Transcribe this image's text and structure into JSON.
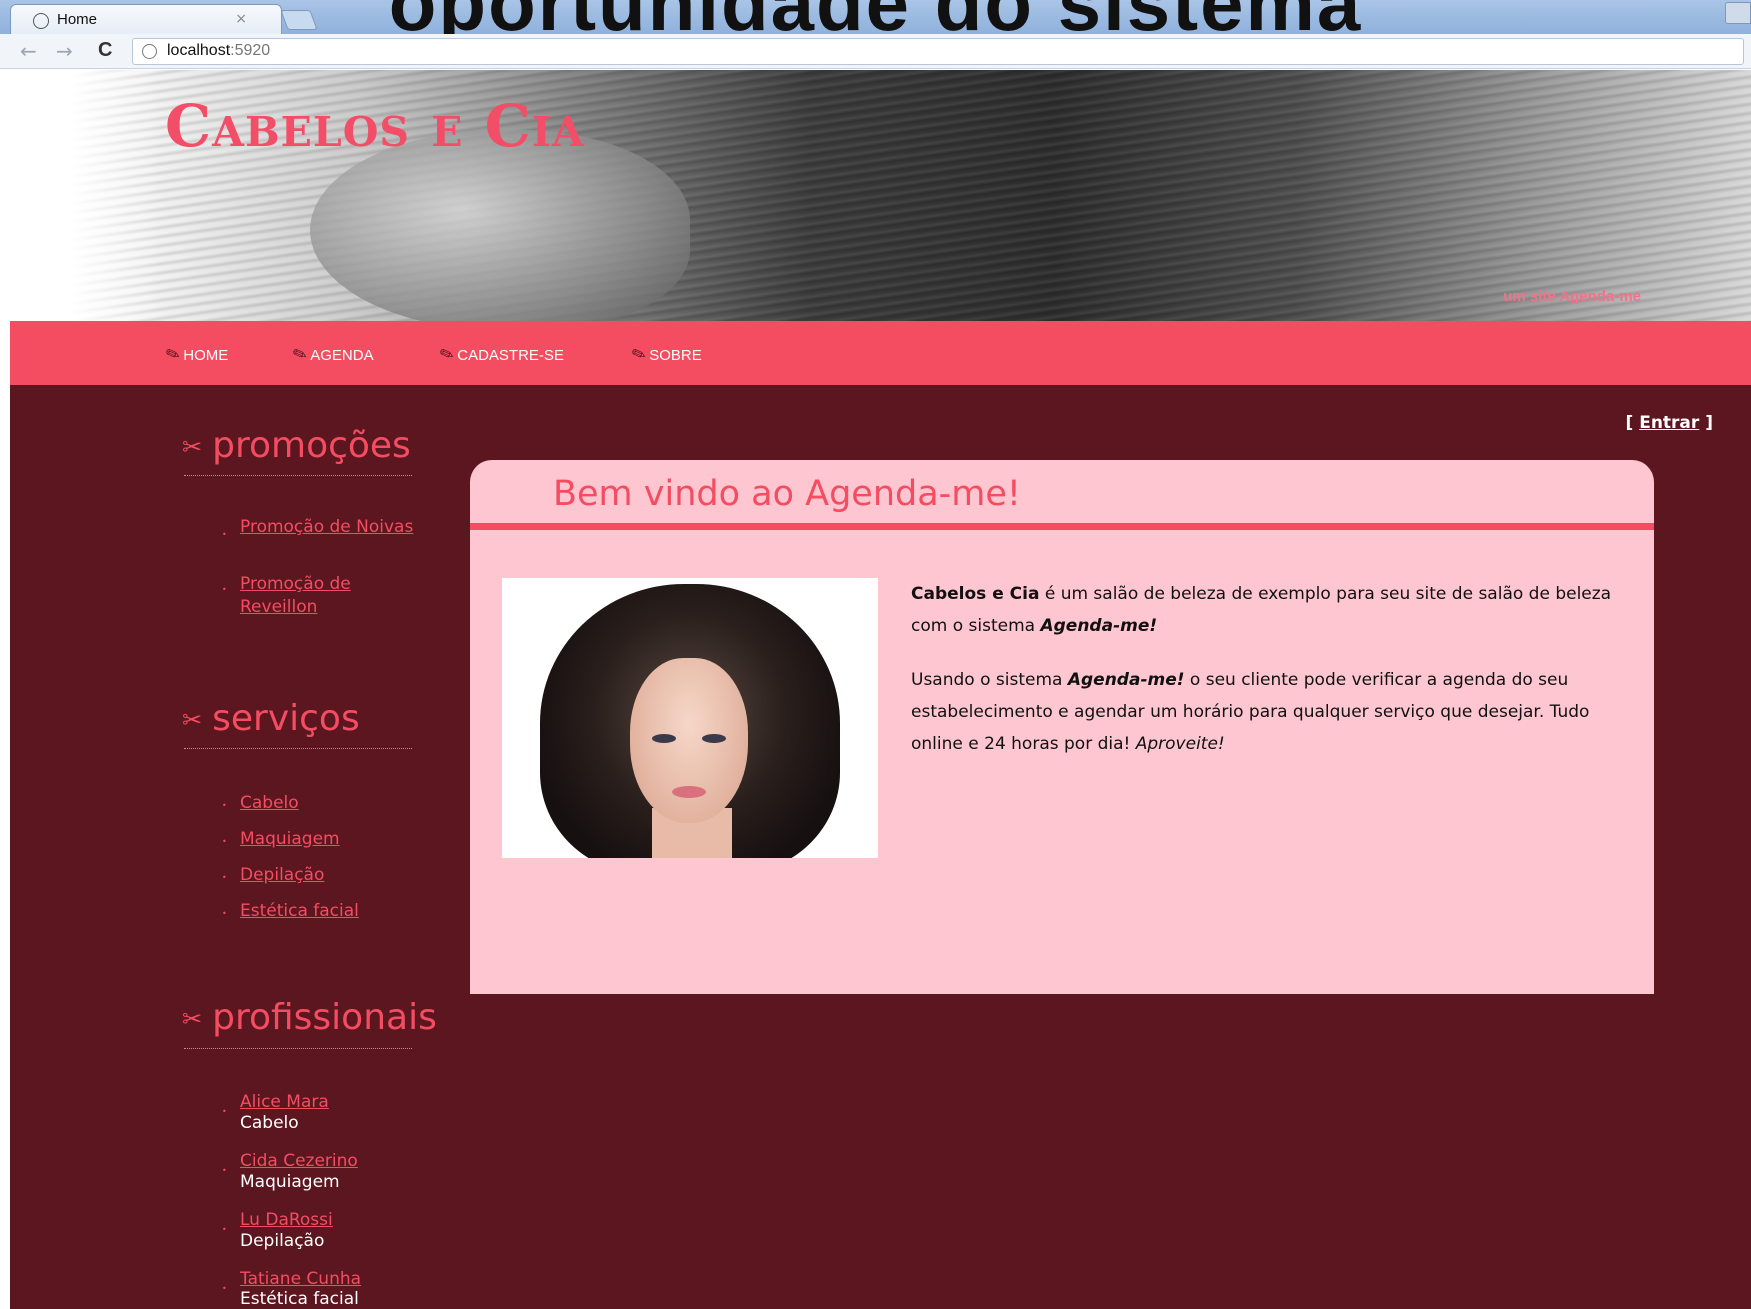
{
  "browser": {
    "overlay_title": "oportunidade do sistema",
    "tab_title": "Home",
    "tab_close": "×",
    "url_host": "localhost",
    "url_port": ":5920",
    "back_icon": "←",
    "forward_icon": "→",
    "reload_icon": "C"
  },
  "site": {
    "brand": "Cabelos e Cia",
    "tagline": "um site Agenda-me",
    "menu": [
      "HOME",
      "AGENDA",
      "CADASTRE-SE",
      "SOBRE"
    ],
    "login_open": "[",
    "login_label": "Entrar",
    "login_close": "]"
  },
  "sidebar": {
    "promocoes": {
      "title": "promoções",
      "items": [
        "Promoção de Noivas",
        "Promoção de Reveillon"
      ]
    },
    "servicos": {
      "title": "serviços",
      "items": [
        "Cabelo",
        "Maquiagem",
        "Depilação",
        "Estética facial"
      ]
    },
    "profissionais": {
      "title": "profissionais",
      "items": [
        {
          "name": "Alice Mara",
          "role": "Cabelo"
        },
        {
          "name": "Cida Cezerino",
          "role": "Maquiagem"
        },
        {
          "name": "Lu DaRossi",
          "role": "Depilação"
        },
        {
          "name": "Tatiane Cunha",
          "role": "Estética facial"
        }
      ]
    }
  },
  "main": {
    "title": "Bem vindo ao Agenda-me!",
    "p1_bold": "Cabelos e Cia",
    "p1_rest": " é um salão de beleza de exemplo para seu site de salão de beleza com o sistema ",
    "p1_em": "Agenda-me!",
    "p2_start": "Usando o sistema ",
    "p2_em": "Agenda-me!",
    "p2_rest": " o seu cliente pode verificar a agenda do seu estabelecimento e agendar um horário para qualquer serviço que desejar. Tudo online e 24 horas por dia! ",
    "p2_end": "Aproveite!"
  },
  "colors": {
    "accent": "#f44d62",
    "background": "#5c1620",
    "content_bg": "#fdc6d0"
  }
}
